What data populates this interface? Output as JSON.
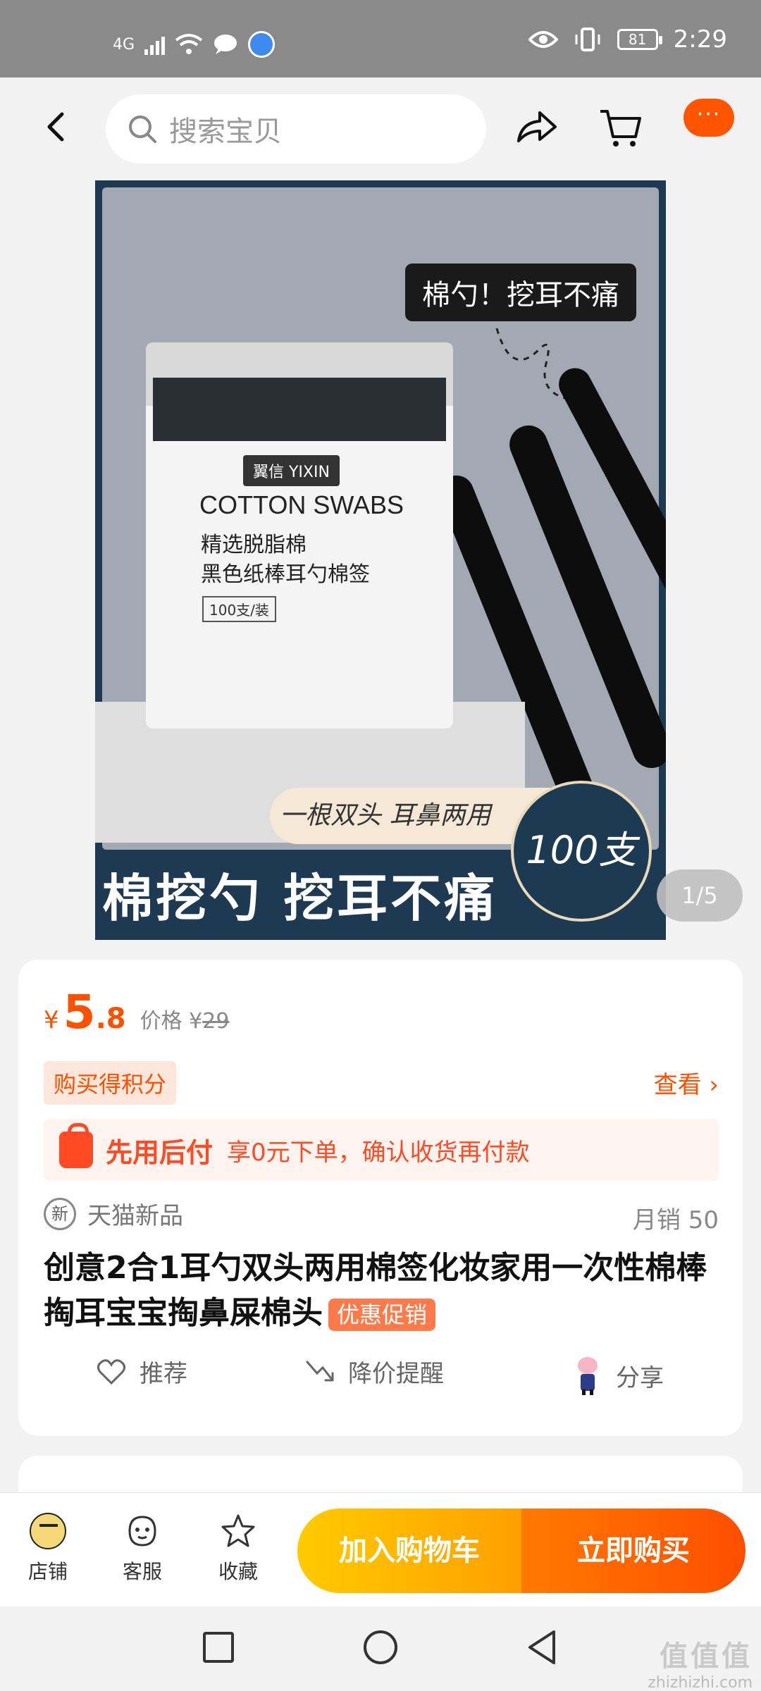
{
  "status_bar": {
    "network": "4G",
    "time": "2:29",
    "battery": "81"
  },
  "nav": {
    "search_placeholder": "搜索宝贝",
    "more_label": "···"
  },
  "gallery": {
    "counter": "1/5",
    "image": {
      "top_tag": "棉勺！挖耳不痛",
      "brand": "翼信 YIXIN",
      "box_title": "COTTON SWABS",
      "box_sub1": "精选脱脂棉",
      "box_sub2": "黑色纸棒耳勺棉签",
      "box_count": "100支/装",
      "banner": "一根双头 耳鼻两用",
      "circle": "100支",
      "slogan": "棉挖勺 挖耳不痛"
    }
  },
  "product": {
    "currency": "¥",
    "price_int": "5",
    "price_dec": ".8",
    "orig_label": "价格",
    "orig_currency": "¥",
    "orig_price": "29",
    "points_badge": "购买得积分",
    "points_link": "查看 ›",
    "pay_later_title": "先用后付",
    "pay_later_desc": "享0元下单，确认收货再付款",
    "new_badge": "新",
    "source": "天猫新品",
    "sales": "月销 50",
    "title": "创意2合1耳勺双头两用棉签化妆家用一次性棉棒掏耳宝宝掏鼻屎棉头",
    "promo_tag": "优惠促销",
    "actions": {
      "recommend": "推荐",
      "price_alert": "降价提醒",
      "share": "分享"
    }
  },
  "bottom_bar": {
    "store": "店铺",
    "service": "客服",
    "favorite": "收藏",
    "add_to_cart": "加入购物车",
    "buy_now": "立即购买"
  },
  "watermark": {
    "top": "值值值",
    "bottom": "zhizhizhi.com"
  },
  "colors": {
    "accent": "#ff5000",
    "cart_gradient": "#ffcb00",
    "buy_gradient": "#ff4e00"
  }
}
